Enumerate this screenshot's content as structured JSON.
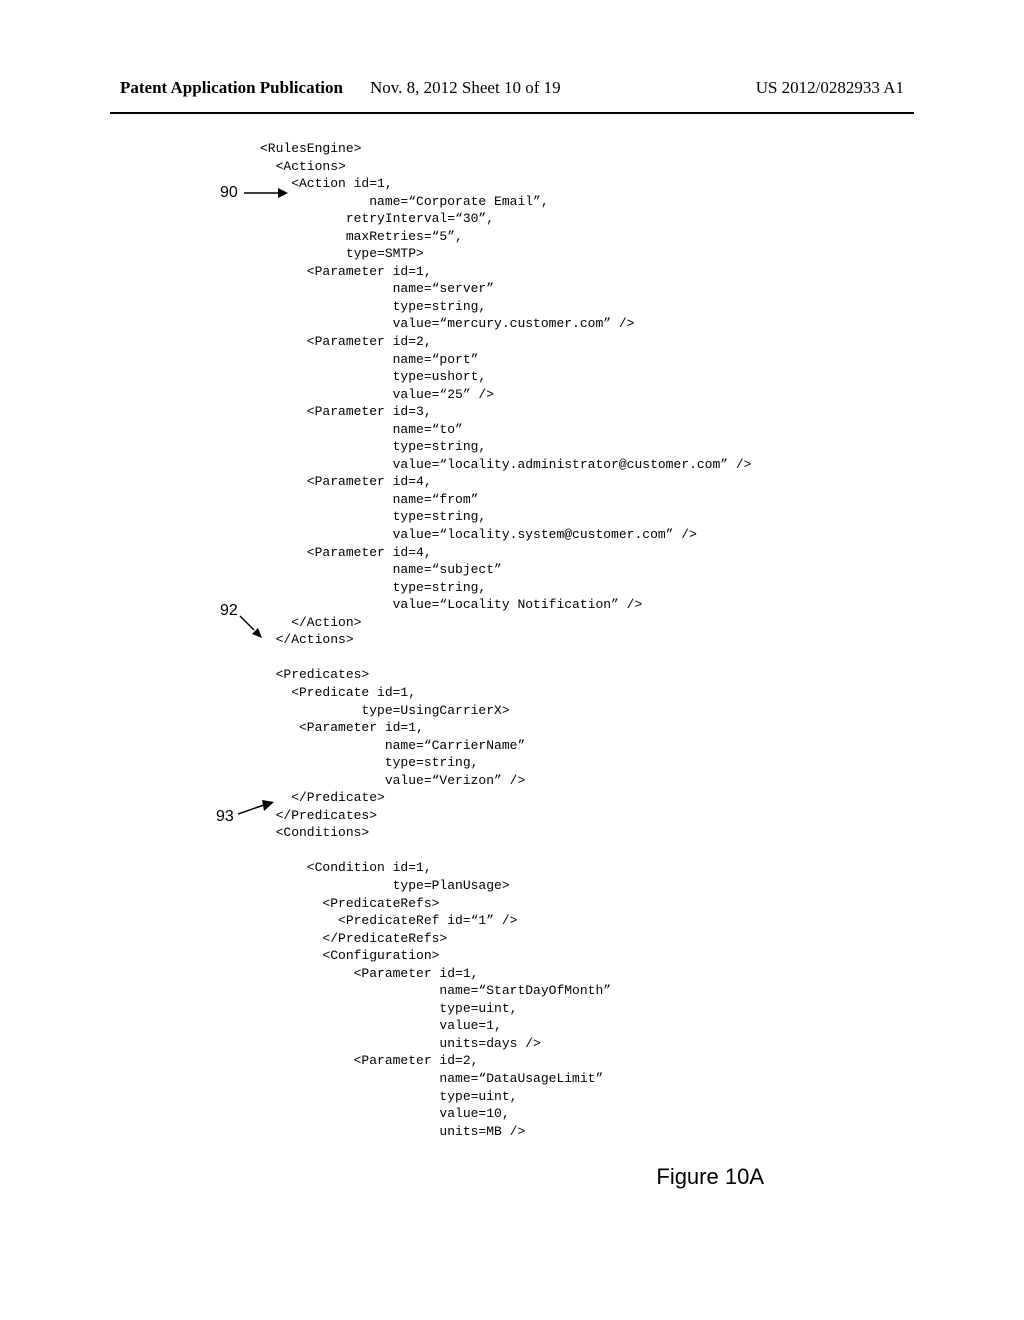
{
  "header": {
    "left": "Patent Application Publication",
    "mid": "Nov. 8, 2012  Sheet 10 of 19",
    "right": "US 2012/0282933 A1"
  },
  "refs": {
    "r90": "90",
    "r92": "92",
    "r93": "93"
  },
  "figure_label": "Figure 10A",
  "code": "<RulesEngine>\n  <Actions>\n    <Action id=1,\n              name=“Corporate Email”,\n           retryInterval=“30”,\n           maxRetries=“5”,\n           type=SMTP>\n      <Parameter id=1,\n                 name=“server”\n                 type=string,\n                 value=“mercury.customer.com” />\n      <Parameter id=2,\n                 name=“port”\n                 type=ushort,\n                 value=“25” />\n      <Parameter id=3,\n                 name=“to”\n                 type=string,\n                 value=“locality.administrator@customer.com” />\n      <Parameter id=4,\n                 name=“from”\n                 type=string,\n                 value=“locality.system@customer.com” />\n      <Parameter id=4,\n                 name=“subject”\n                 type=string,\n                 value=“Locality Notification” />\n    </Action>\n  </Actions>\n\n  <Predicates>\n    <Predicate id=1,\n             type=UsingCarrierX>\n     <Parameter id=1,\n                name=“CarrierName”\n                type=string,\n                value=“Verizon” />\n    </Predicate>\n  </Predicates>\n  <Conditions>\n\n      <Condition id=1,\n                 type=PlanUsage>\n        <PredicateRefs>\n          <PredicateRef id=“1” />\n        </PredicateRefs>\n        <Configuration>\n            <Parameter id=1,\n                       name=“StartDayOfMonth”\n                       type=uint,\n                       value=1,\n                       units=days />\n            <Parameter id=2,\n                       name=“DataUsageLimit”\n                       type=uint,\n                       value=10,\n                       units=MB />"
}
